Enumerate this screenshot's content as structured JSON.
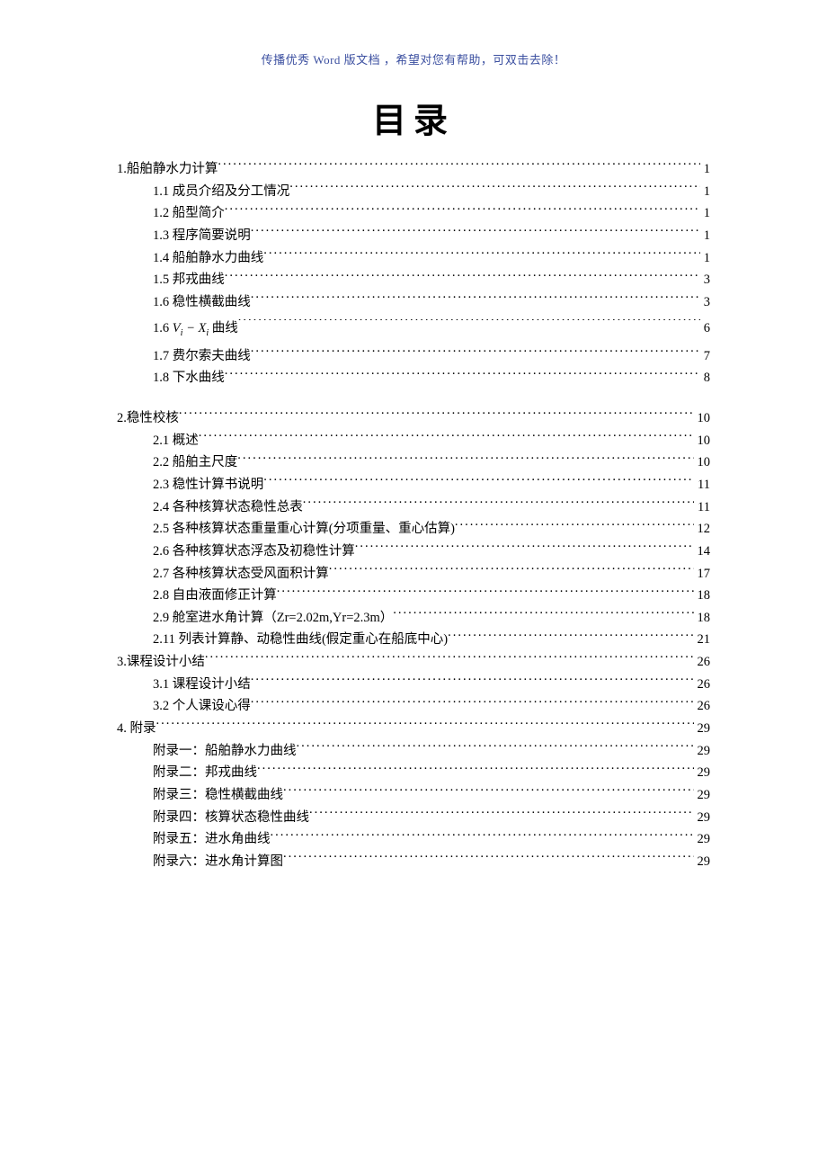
{
  "header_note": "传播优秀 Word 版文档 ，希望对您有帮助，可双击去除！",
  "title": "目录",
  "toc": [
    {
      "level": 1,
      "label": "1.船舶静水力计算",
      "page": "1"
    },
    {
      "level": 2,
      "label": "1.1 成员介绍及分工情况",
      "page": "1"
    },
    {
      "level": 2,
      "label": "1.2 船型简介",
      "page": "1"
    },
    {
      "level": 2,
      "label": "1.3 程序简要说明",
      "page": "1"
    },
    {
      "level": 2,
      "label": "1.4 船舶静水力曲线",
      "page": "1"
    },
    {
      "level": 2,
      "label": "1.5 邦戎曲线",
      "page": "3"
    },
    {
      "level": 2,
      "label": "1.6 稳性横截曲线",
      "page": "3"
    },
    {
      "level": 2,
      "label": "FORMULA_VX",
      "page": "6",
      "special": "vx"
    },
    {
      "level": 2,
      "label": "1.7 费尔索夫曲线",
      "page": "7"
    },
    {
      "level": 2,
      "label": "1.8 下水曲线",
      "page": "8"
    },
    {
      "level": 0,
      "gap": true
    },
    {
      "level": 1,
      "label": "2.稳性校核",
      "page": "10"
    },
    {
      "level": 2,
      "label": "2.1 概述",
      "page": "10"
    },
    {
      "level": 2,
      "label": "2.2 船舶主尺度",
      "page": "10"
    },
    {
      "level": 2,
      "label": "2.3 稳性计算书说明",
      "page": "11"
    },
    {
      "level": 2,
      "label": "2.4 各种核算状态稳性总表",
      "page": "11"
    },
    {
      "level": 2,
      "label": "2.5 各种核算状态重量重心计算(分项重量、重心估算)",
      "page": "12"
    },
    {
      "level": 2,
      "label": "2.6 各种核算状态浮态及初稳性计算",
      "page": "14"
    },
    {
      "level": 2,
      "label": "2.7 各种核算状态受风面积计算",
      "page": "17"
    },
    {
      "level": 2,
      "label": "2.8 自由液面修正计算",
      "page": "18"
    },
    {
      "level": 2,
      "label": "2.9 舱室进水角计算（Zr=2.02m,Yr=2.3m）",
      "page": "18"
    },
    {
      "level": 2,
      "label": "2.11 列表计算静、动稳性曲线(假定重心在船底中心)",
      "page": "21"
    },
    {
      "level": 1,
      "label": "3.课程设计小结",
      "page": "26"
    },
    {
      "level": 2,
      "label": "3.1 课程设计小结",
      "page": "26"
    },
    {
      "level": 2,
      "label": "3.2 个人课设心得",
      "page": "26"
    },
    {
      "level": 1,
      "label": "4. 附录",
      "page": "29"
    },
    {
      "level": 2,
      "label": "附录一：船舶静水力曲线",
      "page": "29"
    },
    {
      "level": 2,
      "label": "附录二：邦戎曲线",
      "page": "29"
    },
    {
      "level": 2,
      "label": "附录三：稳性横截曲线",
      "page": "29"
    },
    {
      "level": 2,
      "label": "附录四：核算状态稳性曲线",
      "page": "29"
    },
    {
      "level": 2,
      "label": "附录五：进水角曲线",
      "page": "29"
    },
    {
      "level": 2,
      "label": "附录六：进水角计算图",
      "page": "29"
    }
  ],
  "vx_prefix": "1.6  ",
  "vx_suffix": " 曲线"
}
